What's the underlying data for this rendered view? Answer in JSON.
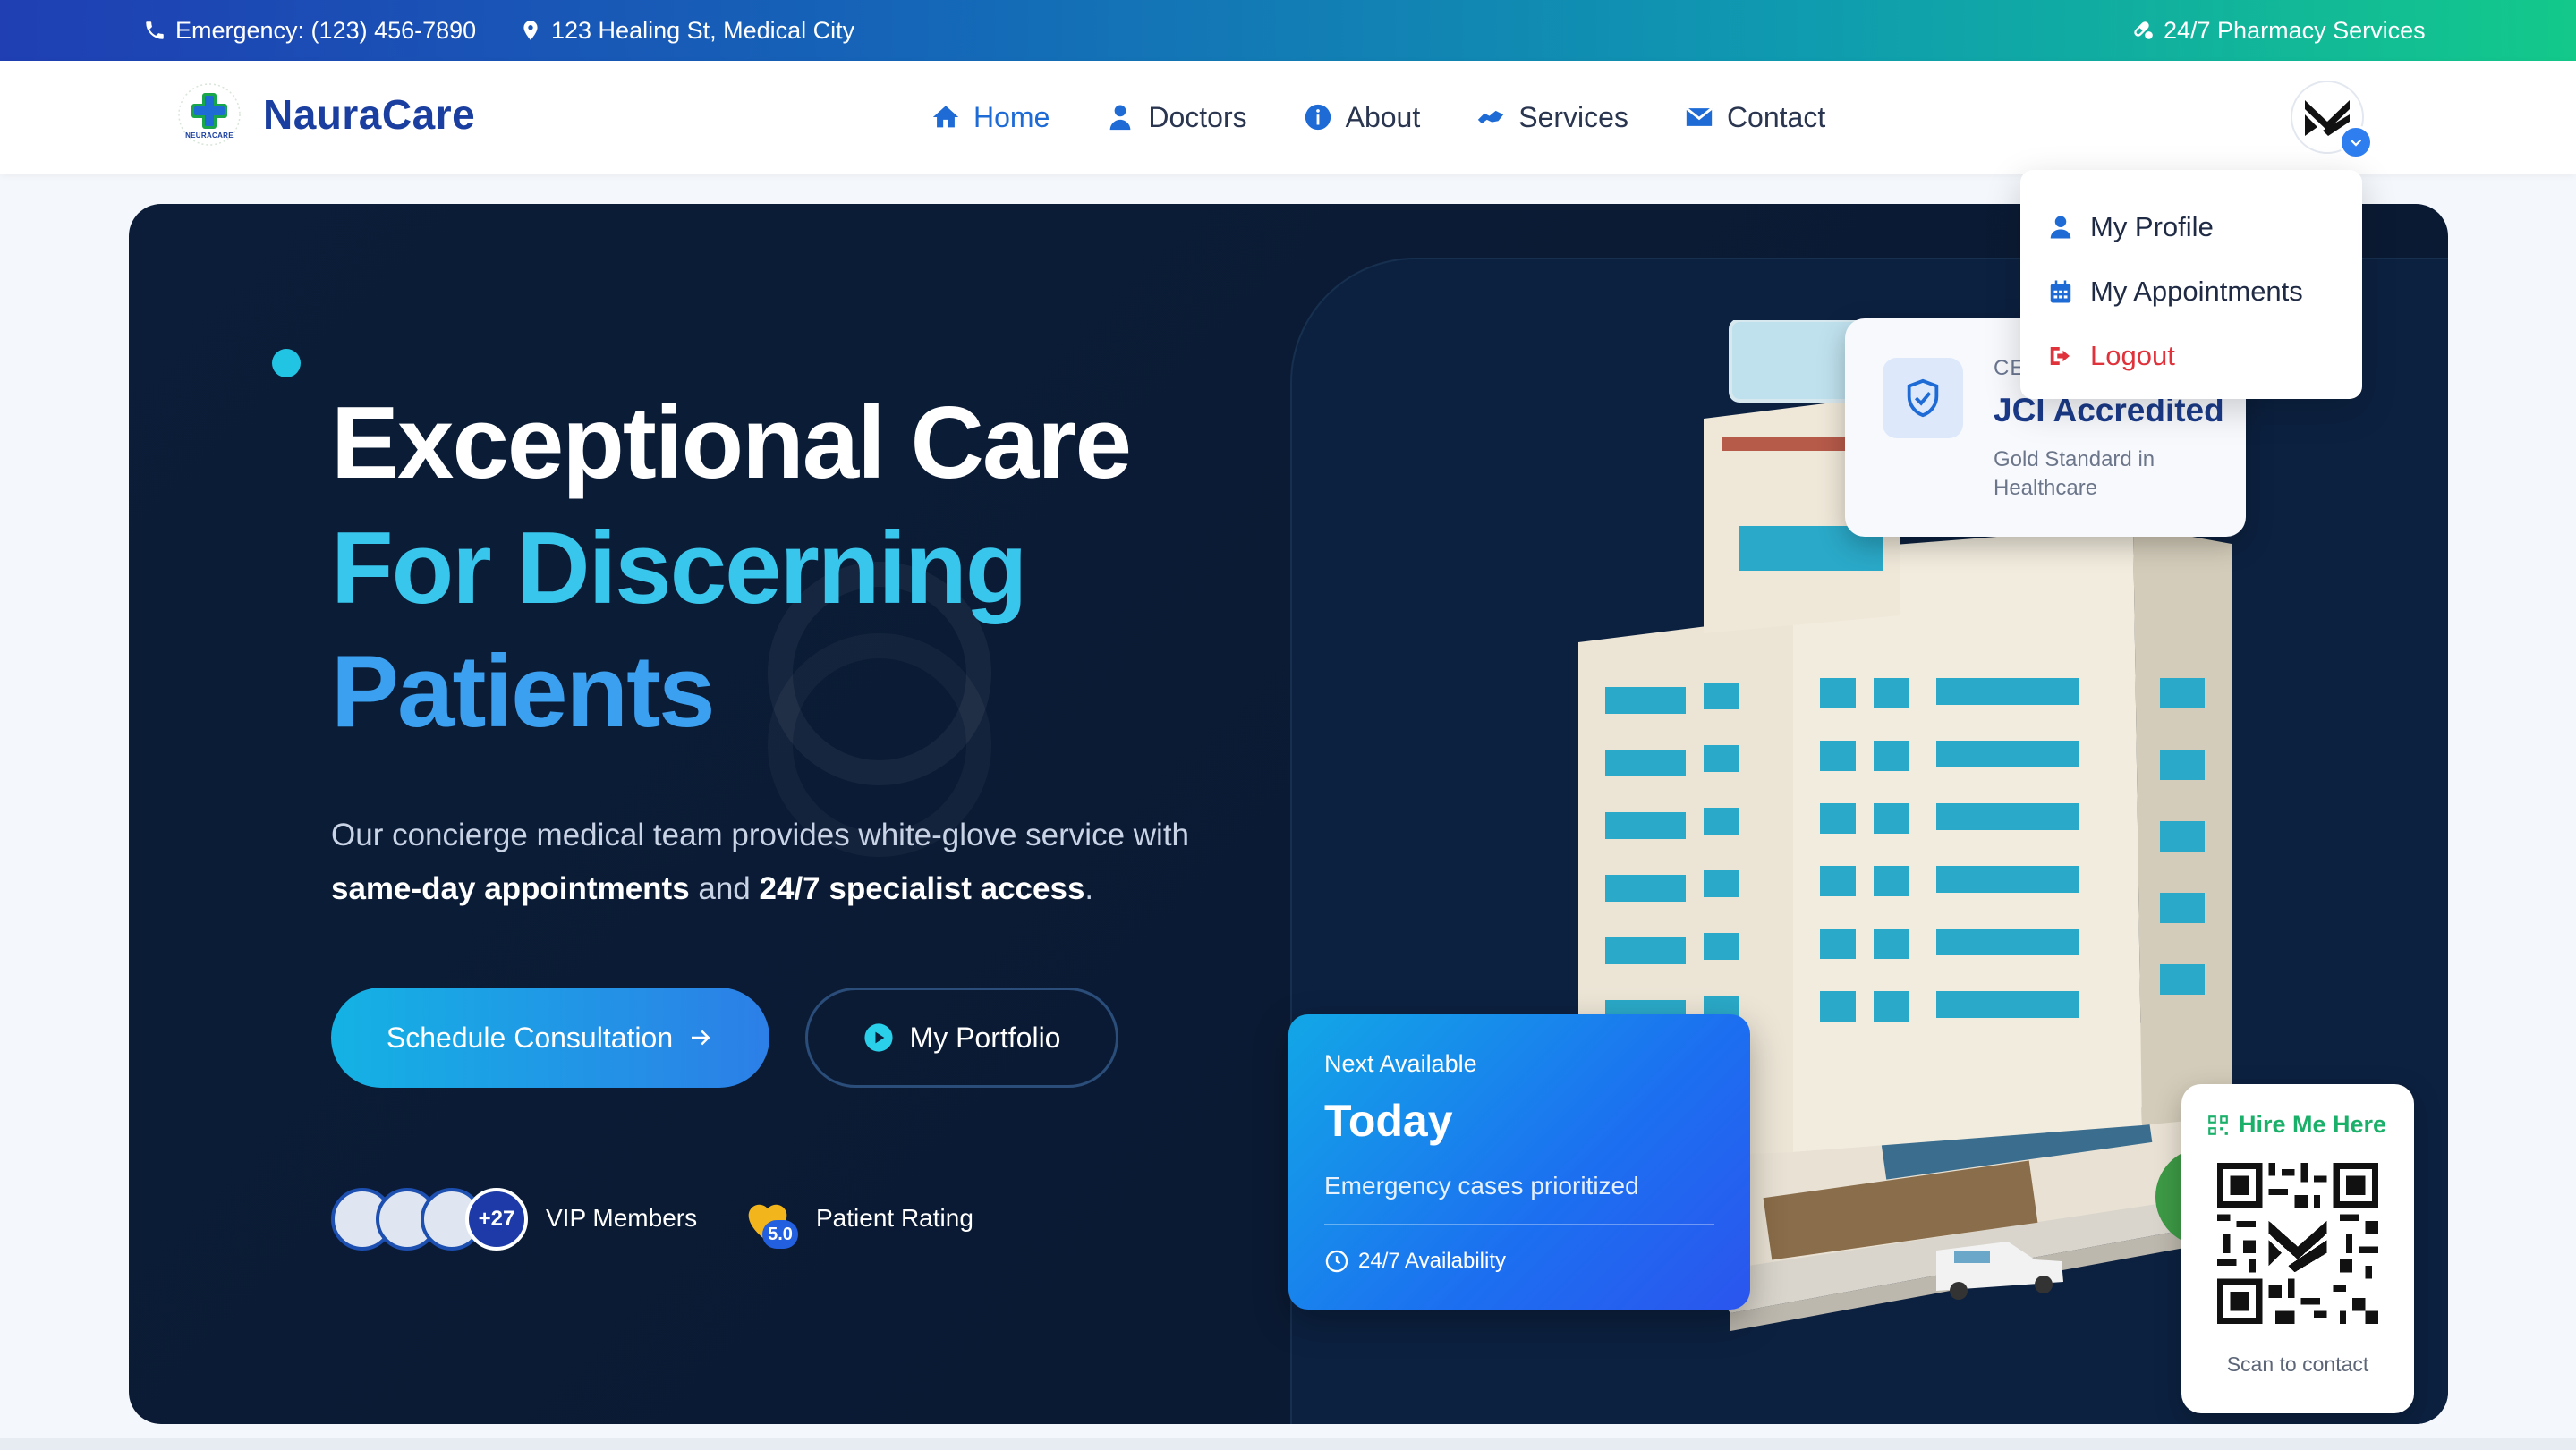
{
  "topbar": {
    "emergency": "Emergency: (123) 456-7890",
    "address": "123 Healing St, Medical City",
    "pharmacy": "24/7 Pharmacy Services"
  },
  "brand": {
    "name": "NauraCare",
    "logo_text": "NEURACARE"
  },
  "nav": {
    "items": [
      {
        "label": "Home",
        "icon": "home-icon",
        "active": true
      },
      {
        "label": "Doctors",
        "icon": "doctor-icon"
      },
      {
        "label": "About",
        "icon": "info-icon"
      },
      {
        "label": "Services",
        "icon": "hands-icon"
      },
      {
        "label": "Contact",
        "icon": "envelope-icon"
      }
    ]
  },
  "user_menu": {
    "items": [
      {
        "label": "My Profile",
        "icon": "user-icon"
      },
      {
        "label": "My Appointments",
        "icon": "calendar-icon"
      },
      {
        "label": "Logout",
        "icon": "logout-icon"
      }
    ]
  },
  "hero": {
    "title_line1": "Exceptional Care",
    "title_line2": "For Discerning",
    "title_line3": "Patients",
    "desc_prefix": "Our concierge medical team provides white-glove service with",
    "desc_bold1": "same-day appointments",
    "desc_mid": " and ",
    "desc_bold2": "24/7 specialist access",
    "desc_suffix": ".",
    "cta_primary": "Schedule Consultation",
    "cta_secondary": "My Portfolio",
    "members_count": "+27",
    "members_label": "VIP Members",
    "rating_value": "5.0",
    "rating_label": "Patient Rating"
  },
  "accreditation": {
    "eyebrow": "CE",
    "title": "JCI Accredited",
    "subtitle": "Gold Standard in Healthcare"
  },
  "availability": {
    "eyebrow": "Next Available",
    "title": "Today",
    "subtitle": "Emergency cases prioritized",
    "footer": "24/7 Availability"
  },
  "qr": {
    "title": "Hire Me Here",
    "caption": "Scan to contact"
  },
  "colors": {
    "brand_blue": "#1b3fa0",
    "accent_cyan": "#38c6ec",
    "accent_blue": "#3aa0ef",
    "hero_bg": "#0b1d38",
    "logout_red": "#e0323b",
    "qr_green": "#1bb06a"
  }
}
